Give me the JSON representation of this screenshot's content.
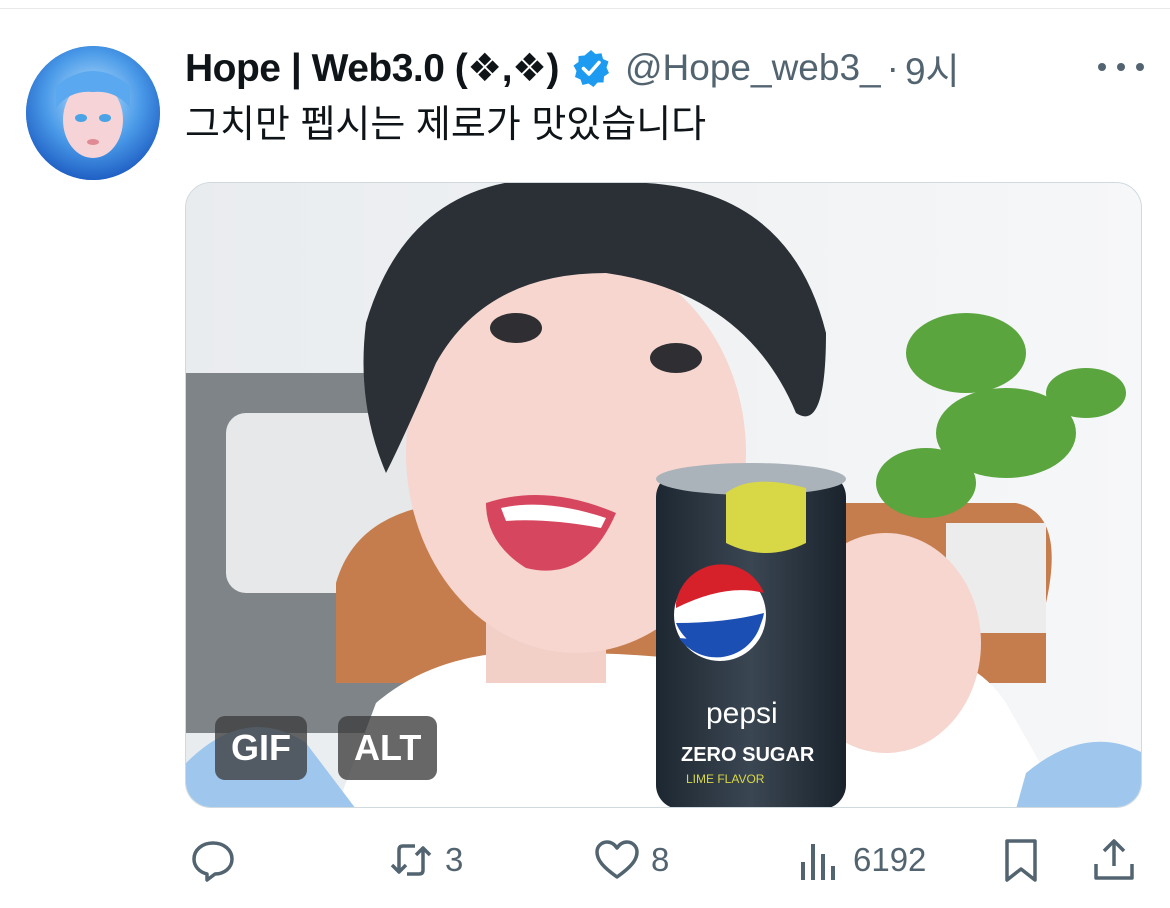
{
  "tweet": {
    "author": {
      "display_name": "Hope | Web3.0 (❖,❖)",
      "handle": "@Hope_web3_",
      "verified": true
    },
    "separator": "·",
    "time": "9시",
    "text": "그치만 펩시는 제로가 맛있습니다",
    "media": {
      "type": "gif",
      "gif_badge": "GIF",
      "alt_badge": "ALT",
      "can_brand": "pepsi",
      "can_subtitle": "ZERO SUGAR",
      "can_flavor": "LIME FLAVOR"
    },
    "actions": {
      "reply": {
        "icon": "reply-icon"
      },
      "retweet": {
        "icon": "retweet-icon",
        "count": "3"
      },
      "like": {
        "icon": "heart-icon",
        "count": "8"
      },
      "views": {
        "icon": "views-icon",
        "count": "6192"
      },
      "bookmark": {
        "icon": "bookmark-icon"
      },
      "share": {
        "icon": "share-icon"
      }
    }
  },
  "colors": {
    "text": "#0f1419",
    "secondary": "#536471",
    "verified": "#1d9bf0",
    "divider": "#e7e9ea"
  }
}
